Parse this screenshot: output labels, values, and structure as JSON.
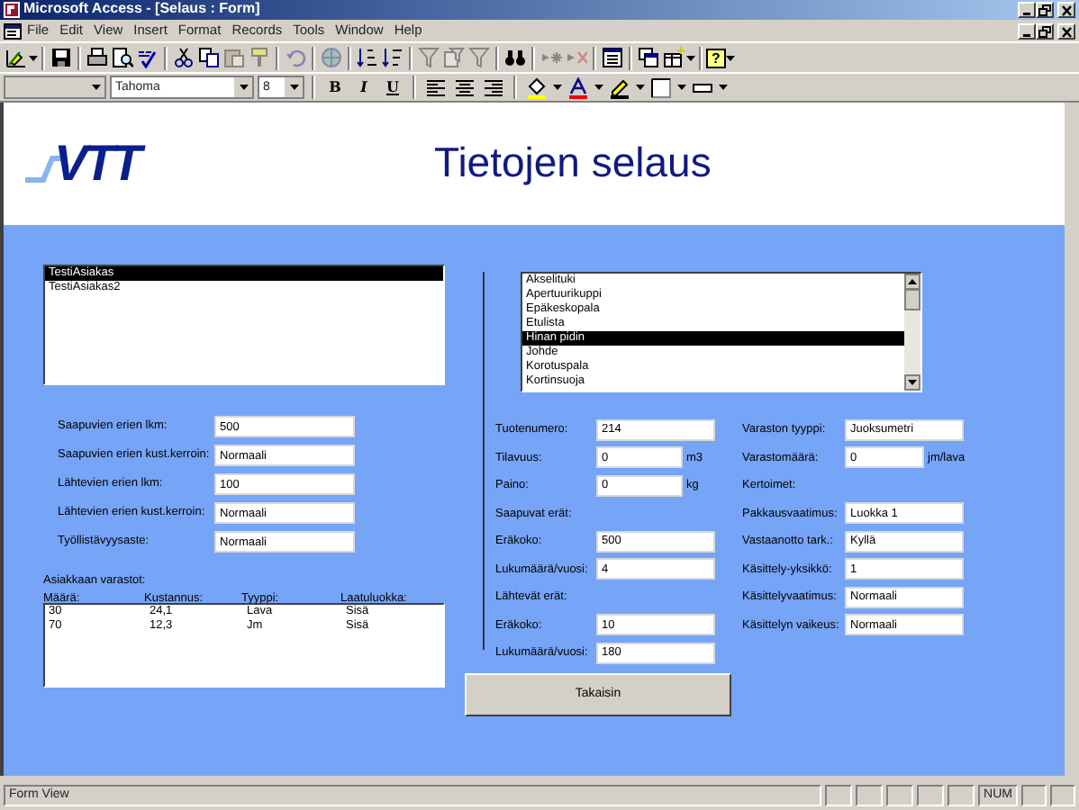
{
  "window": {
    "title": "Microsoft Access - [Selaus : Form]"
  },
  "menu": [
    {
      "label": "File"
    },
    {
      "label": "Edit"
    },
    {
      "label": "View"
    },
    {
      "label": "Insert"
    },
    {
      "label": "Format"
    },
    {
      "label": "Records"
    },
    {
      "label": "Tools"
    },
    {
      "label": "Window"
    },
    {
      "label": "Help"
    }
  ],
  "toolbar": [
    {
      "kind": "view",
      "disabled": false
    },
    {
      "kind": "separator"
    },
    {
      "kind": "save",
      "disabled": false
    },
    {
      "kind": "separator"
    },
    {
      "kind": "print",
      "disabled": false
    },
    {
      "kind": "preview",
      "disabled": false
    },
    {
      "kind": "spelling",
      "disabled": false
    },
    {
      "kind": "separator"
    },
    {
      "kind": "cut",
      "disabled": false
    },
    {
      "kind": "copy",
      "disabled": false
    },
    {
      "kind": "paste",
      "disabled": true
    },
    {
      "kind": "painter",
      "disabled": true
    },
    {
      "kind": "separator"
    },
    {
      "kind": "undo",
      "disabled": true
    },
    {
      "kind": "separator"
    },
    {
      "kind": "hyperlink",
      "disabled": true
    },
    {
      "kind": "separator"
    },
    {
      "kind": "sortasc",
      "disabled": false
    },
    {
      "kind": "sortdesc",
      "disabled": false
    },
    {
      "kind": "separator"
    },
    {
      "kind": "filter",
      "disabled": true
    },
    {
      "kind": "filterform",
      "disabled": true
    },
    {
      "kind": "filter",
      "disabled": true
    },
    {
      "kind": "separator"
    },
    {
      "kind": "find",
      "disabled": false
    },
    {
      "kind": "separator"
    },
    {
      "kind": "newrecord",
      "disabled": true
    },
    {
      "kind": "deleterecord",
      "disabled": true
    },
    {
      "kind": "separator"
    },
    {
      "kind": "properties",
      "disabled": false
    },
    {
      "kind": "separator"
    },
    {
      "kind": "database",
      "disabled": false
    },
    {
      "kind": "newobject",
      "disabled": false
    },
    {
      "kind": "separator"
    },
    {
      "kind": "help",
      "label": "?",
      "disabled": false
    }
  ],
  "formatting": {
    "font": "Tahoma",
    "size": "8",
    "bold": "B",
    "italic": "I",
    "underline": "U"
  },
  "header": {
    "logo": "VTT",
    "title": "Tietojen selaus"
  },
  "customers": [
    {
      "label": "TestiAsiakas",
      "selected": true
    },
    {
      "label": "TestiAsiakas2",
      "selected": false
    }
  ],
  "customer_fields": [
    {
      "label": "Saapuvien erien lkm:",
      "value": "500"
    },
    {
      "label": "Saapuvien erien kust.kerroin:",
      "value": "Normaali"
    },
    {
      "label": "Lähtevien erien lkm:",
      "value": "100"
    },
    {
      "label": "Lähtevien erien kust.kerroin:",
      "value": "Normaali"
    },
    {
      "label": "Työllistävyysaste:",
      "value": "Normaali"
    }
  ],
  "stocks": {
    "title": "Asiakkaan varastot:",
    "columns": [
      "Määrä:",
      "Kustannus:",
      "Tyyppi:",
      "Laatuluokka:"
    ],
    "rows": [
      [
        "30",
        "24,1",
        "Lava",
        "Sisä"
      ],
      [
        "70",
        "12,3",
        "Jm",
        "Sisä"
      ]
    ]
  },
  "products": [
    {
      "label": "Akselituki",
      "selected": false
    },
    {
      "label": "Apertuurikuppi",
      "selected": false
    },
    {
      "label": "Epäkeskopala",
      "selected": false
    },
    {
      "label": "Etulista",
      "selected": false
    },
    {
      "label": "Hinan pidin",
      "selected": true
    },
    {
      "label": "Johde",
      "selected": false
    },
    {
      "label": "Korotuspala",
      "selected": false
    },
    {
      "label": "Kortinsuoja",
      "selected": false
    }
  ],
  "product_fields": [
    {
      "kind": "field",
      "label": "Tuotenumero:",
      "value": "214"
    },
    {
      "kind": "field",
      "label": "Tilavuus:",
      "value": "0",
      "unit": "m3"
    },
    {
      "kind": "field",
      "label": "Paino:",
      "value": "0",
      "unit": "kg"
    },
    {
      "kind": "heading",
      "label": "Saapuvat erät:"
    },
    {
      "kind": "field",
      "label": "Eräkoko:",
      "value": "500"
    },
    {
      "kind": "field",
      "label": "Lukumäärä/vuosi:",
      "value": "4"
    },
    {
      "kind": "heading",
      "label": "Lähtevät erät:"
    },
    {
      "kind": "field",
      "label": "Eräkoko:",
      "value": "10"
    },
    {
      "kind": "field",
      "label": "Lukumäärä/vuosi:",
      "value": "180"
    }
  ],
  "storage_fields": [
    {
      "kind": "field",
      "label": "Varaston tyyppi:",
      "value": "Juoksumetri"
    },
    {
      "kind": "field",
      "label": "Varastomäärä:",
      "value": "0",
      "unit": "jm/lava"
    },
    {
      "kind": "heading",
      "label": "Kertoimet:"
    },
    {
      "kind": "field",
      "label": "Pakkausvaatimus:",
      "value": "Luokka 1"
    },
    {
      "kind": "field",
      "label": "Vastaanotto tark.:",
      "value": "Kyllä"
    },
    {
      "kind": "field",
      "label": "Käsittely-yksikkö:",
      "value": "1"
    },
    {
      "kind": "field",
      "label": "Käsittelyvaatimus:",
      "value": "Normaali"
    },
    {
      "kind": "field",
      "label": "Käsittelyn vaikeus:",
      "value": "Normaali"
    }
  ],
  "back_button": "Takaisin",
  "status_bar": {
    "text": "Form View",
    "num": "NUM"
  }
}
